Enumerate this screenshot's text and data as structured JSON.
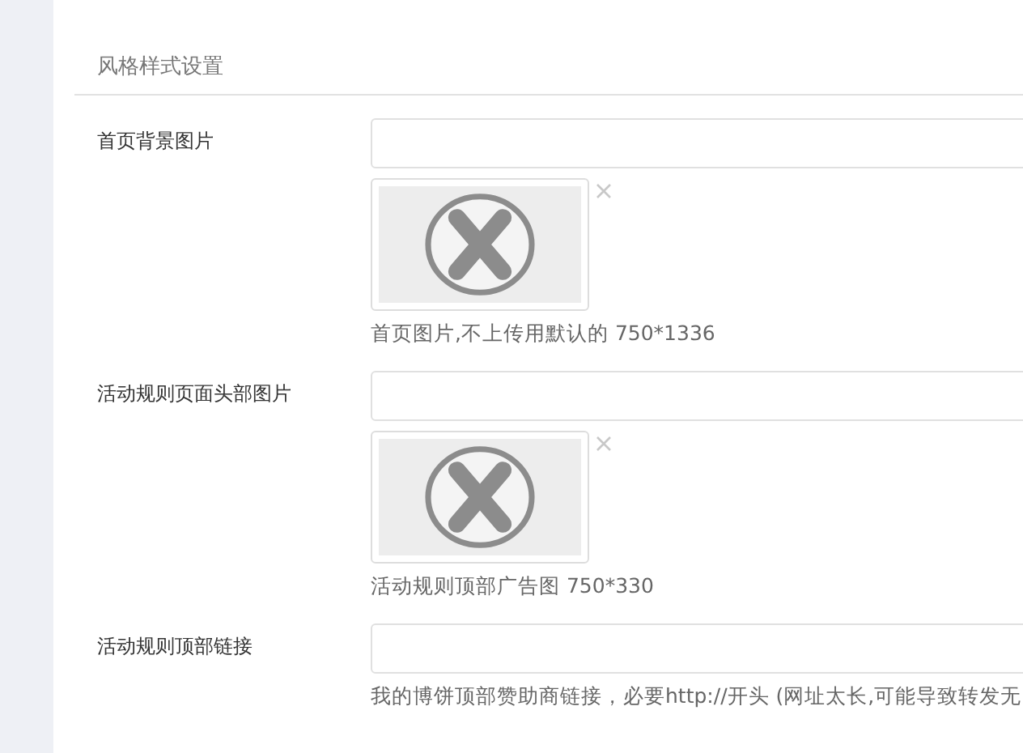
{
  "section": {
    "title": "风格样式设置"
  },
  "fields": [
    {
      "kind": "image",
      "label": "首页背景图片",
      "hint": "首页图片,不上传用默认的 750*1336"
    },
    {
      "kind": "image",
      "label": "活动规则页面头部图片",
      "hint": "活动规则顶部广告图 750*330"
    },
    {
      "kind": "text",
      "label": "活动规则顶部链接",
      "hint": "我的博饼顶部赞助商链接，必要http://开头 (网址太长,可能导致转发无"
    }
  ]
}
